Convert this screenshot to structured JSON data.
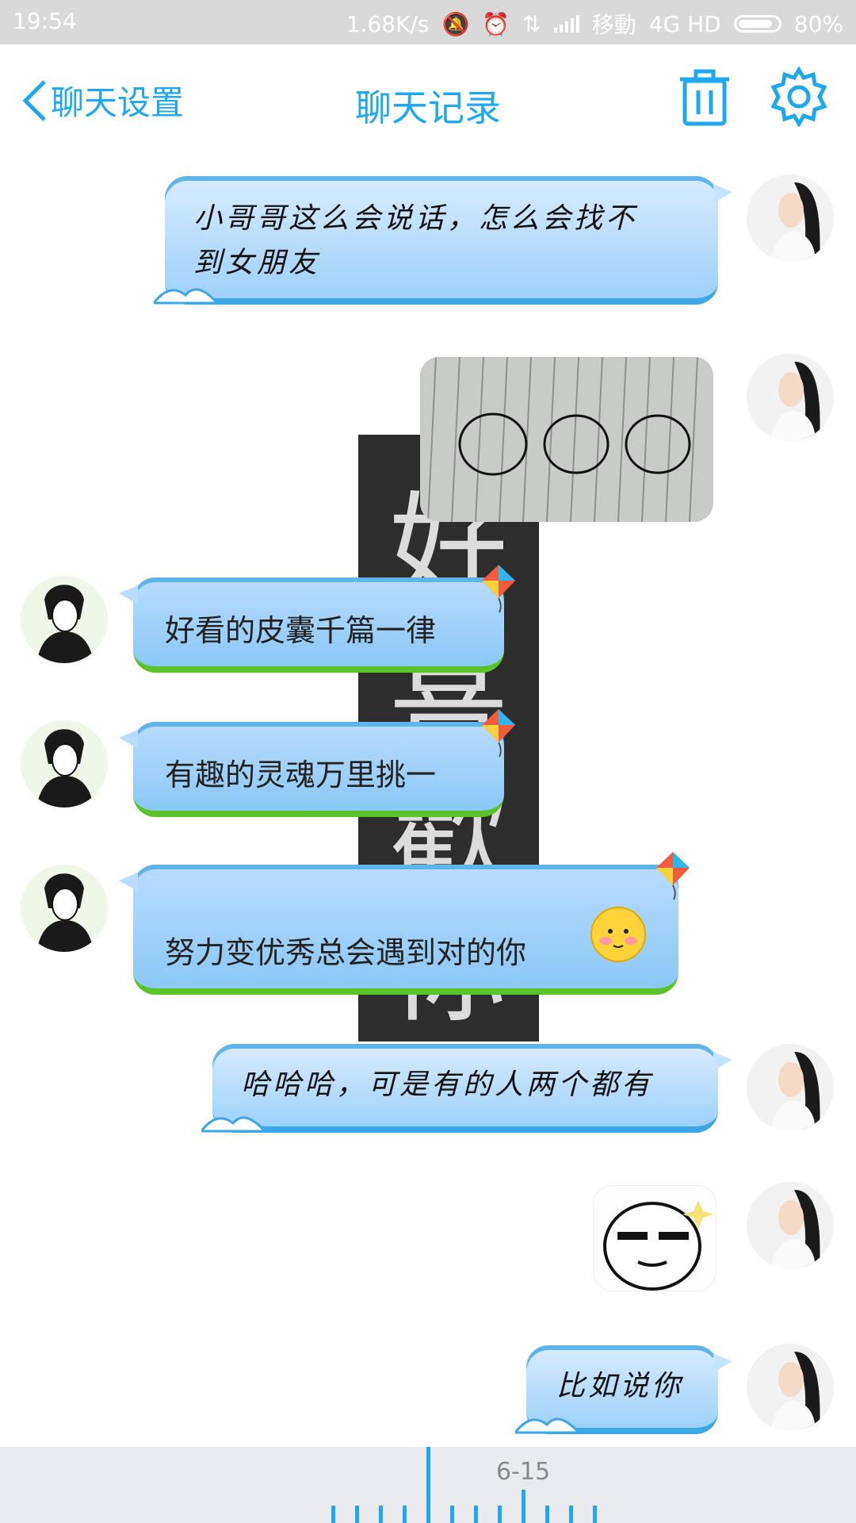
{
  "status_bar": {
    "time": "19:54",
    "net_speed": "1.68K/s",
    "carrier": "移動",
    "network": "4G HD",
    "battery": "80%"
  },
  "header": {
    "back_label": "聊天设置",
    "title": "聊天记录",
    "accent_color": "#1fa7f0"
  },
  "background_poster": {
    "chars": [
      "好",
      "喜",
      "歡",
      "你"
    ]
  },
  "messages": [
    {
      "side": "right",
      "type": "text",
      "text_line1": "小哥哥这么会说话，怎么会找不",
      "text_line2": "到女朋友"
    },
    {
      "side": "right",
      "type": "image",
      "desc": "sketch-cats-image"
    },
    {
      "side": "left",
      "type": "text",
      "text": "好看的皮囊千篇一律"
    },
    {
      "side": "left",
      "type": "text",
      "text": "有趣的灵魂万里挑一"
    },
    {
      "side": "left",
      "type": "text",
      "text": "努力变优秀总会遇到对的你",
      "emoji": "blushing-face"
    },
    {
      "side": "right",
      "type": "text",
      "text": "哈哈哈，可是有的人两个都有"
    },
    {
      "side": "right",
      "type": "sticker",
      "desc": "meme-face-sticker"
    },
    {
      "side": "right",
      "type": "text",
      "text": "比如说你"
    }
  ],
  "timeline": {
    "date": "6-15"
  }
}
